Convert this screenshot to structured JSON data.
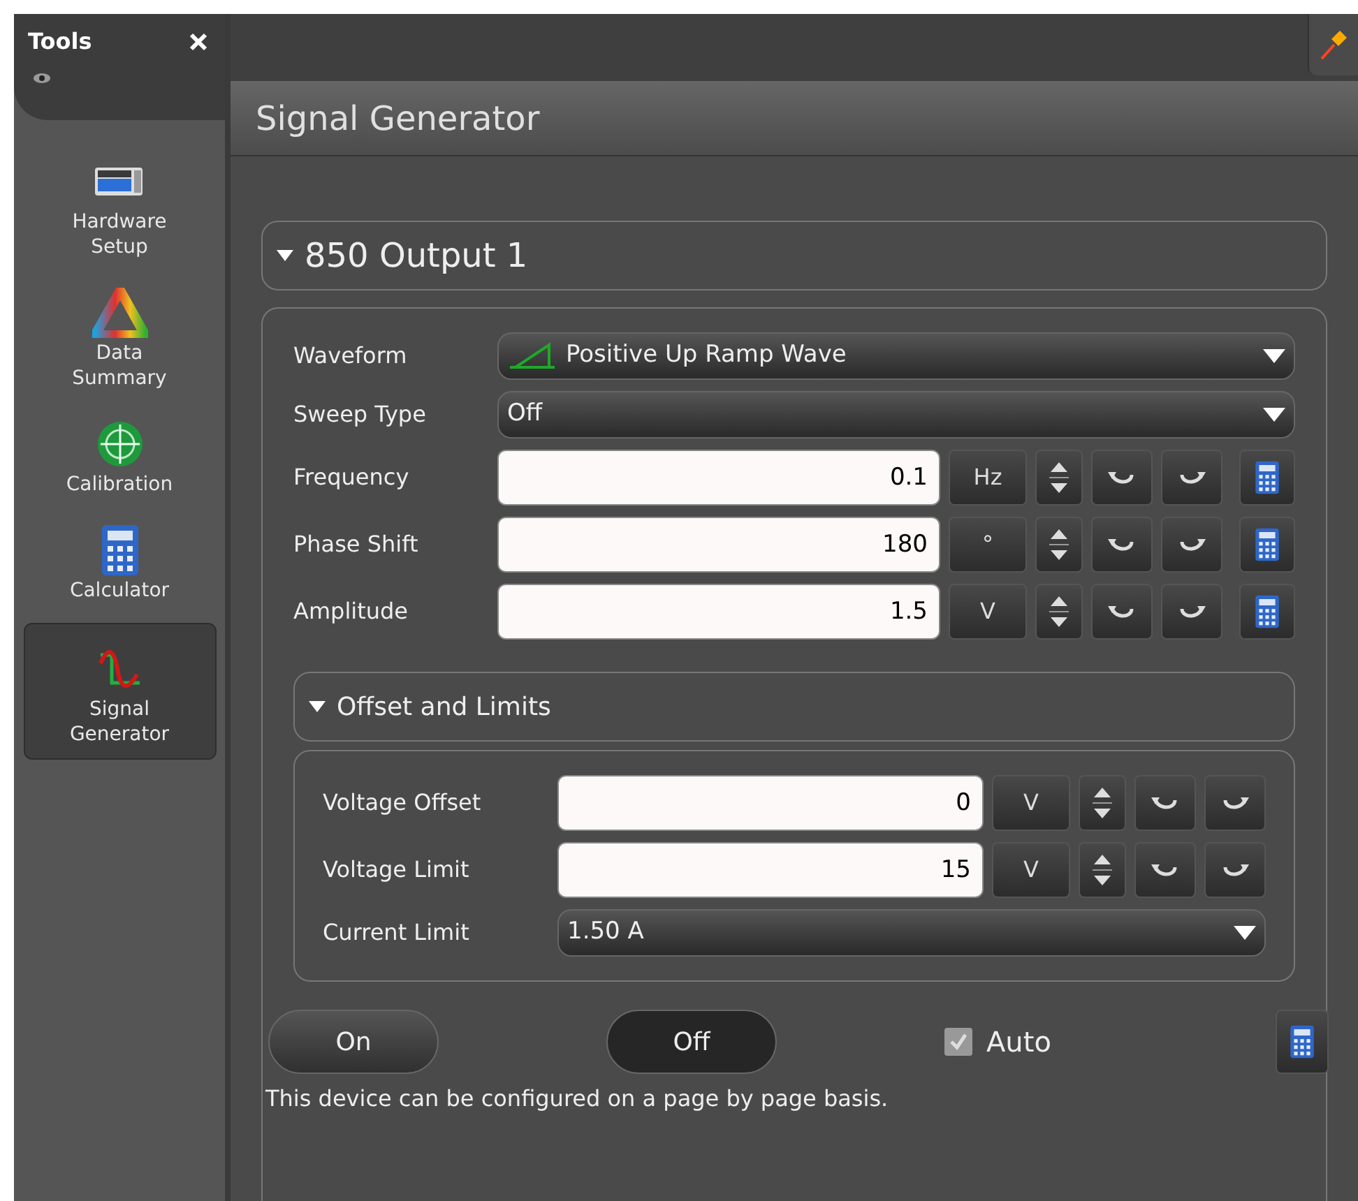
{
  "sidebar": {
    "title": "Tools",
    "items": [
      {
        "label": "Hardware Setup",
        "kind": "hardware",
        "selected": false
      },
      {
        "label": "Data Summary",
        "kind": "summary",
        "selected": false
      },
      {
        "label": "Calibration",
        "kind": "calibration",
        "selected": false
      },
      {
        "label": "Calculator",
        "kind": "calculator",
        "selected": false
      },
      {
        "label": "Signal Generator",
        "kind": "signal",
        "selected": true
      }
    ]
  },
  "panel_title": "Signal Generator",
  "output": {
    "title": "850 Output 1",
    "expanded": true,
    "rows": [
      {
        "kind": "waveform",
        "label": "Waveform",
        "value": "Positive Up Ramp Wave"
      },
      {
        "kind": "select",
        "label": "Sweep Type",
        "value": "Off"
      },
      {
        "kind": "number",
        "label": "Frequency",
        "value": "0.1",
        "unit": "Hz"
      },
      {
        "kind": "number",
        "label": "Phase Shift",
        "value": "180",
        "unit": "°"
      },
      {
        "kind": "number",
        "label": "Amplitude",
        "value": "1.5",
        "unit": "V"
      }
    ],
    "limits": {
      "title": "Offset and Limits",
      "expanded": true,
      "rows": [
        {
          "kind": "number",
          "label": "Voltage Offset",
          "value": "0",
          "unit": "V"
        },
        {
          "kind": "number",
          "label": "Voltage Limit",
          "value": "15",
          "unit": "V"
        },
        {
          "kind": "select",
          "label": "Current Limit",
          "value": "1.50 A"
        }
      ]
    },
    "buttons": [
      {
        "label": "On",
        "selected": false
      },
      {
        "label": "Off",
        "selected": true
      }
    ],
    "auto": {
      "label": "Auto",
      "checked": true
    },
    "note": "This device can be configured on a page by page basis."
  }
}
